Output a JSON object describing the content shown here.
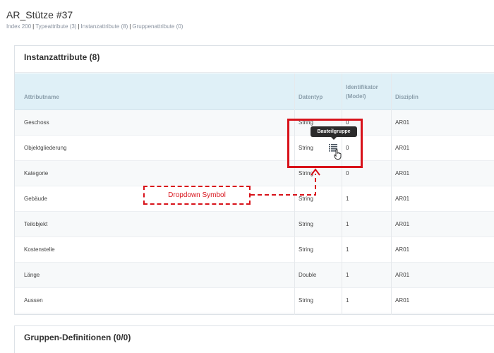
{
  "page": {
    "title": "AR_Stütze #37",
    "breadcrumb": [
      "Index 200",
      "Typeattribute (3)",
      "Instanzattribute (8)",
      "Gruppenattribute (0)"
    ]
  },
  "instance_card": {
    "title": "Instanzattribute (8)",
    "columns": [
      "Attributname",
      "Datentyp",
      "Identifikator (Model)",
      "Disziplin"
    ],
    "rows": [
      {
        "name": "Geschoss",
        "type": "String",
        "id": "0",
        "disc": "AR01"
      },
      {
        "name": "Objektgliederung",
        "type": "String",
        "id": "0",
        "disc": "AR01"
      },
      {
        "name": "Kategorie",
        "type": "String",
        "id": "0",
        "disc": "AR01"
      },
      {
        "name": "Gebäude",
        "type": "String",
        "id": "1",
        "disc": "AR01"
      },
      {
        "name": "Teilobjekt",
        "type": "String",
        "id": "1",
        "disc": "AR01"
      },
      {
        "name": "Kostenstelle",
        "type": "String",
        "id": "1",
        "disc": "AR01"
      },
      {
        "name": "Länge",
        "type": "Double",
        "id": "1",
        "disc": "AR01"
      },
      {
        "name": "Aussen",
        "type": "String",
        "id": "1",
        "disc": "AR01"
      }
    ]
  },
  "tooltip": "Bauteilgruppe",
  "callout": "Dropdown Symbol",
  "groups_card": {
    "title": "Gruppen-Definitionen (0/0)"
  },
  "icons": {
    "dropdown": "list-icon",
    "pointer": "hand-cursor-icon"
  },
  "colors": {
    "annotation": "#d8121a",
    "header_bg": "#dff0f7"
  }
}
